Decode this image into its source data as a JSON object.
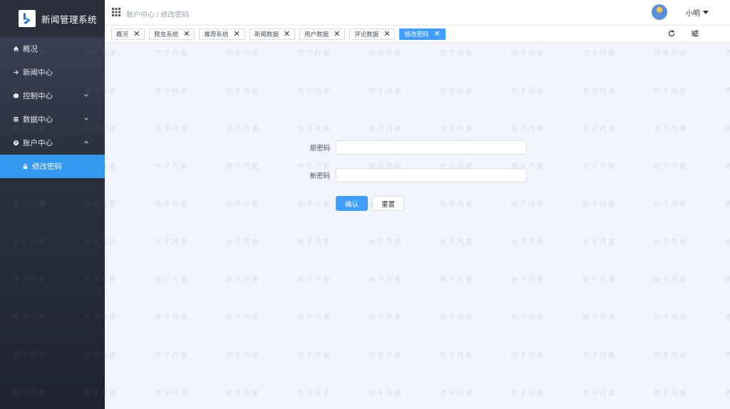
{
  "app": {
    "title": "新闻管理系统"
  },
  "sidebar": {
    "items": [
      {
        "label": "概况",
        "icon": "home-icon"
      },
      {
        "label": "新闻中心",
        "icon": "arrow-right-icon"
      },
      {
        "label": "控制中心",
        "icon": "cube-icon",
        "expandable": true
      },
      {
        "label": "数据中心",
        "icon": "database-icon",
        "expandable": true
      },
      {
        "label": "账户中心",
        "icon": "user-icon",
        "expandable": true,
        "expanded": true
      },
      {
        "label": "修改密码",
        "icon": "lock-icon",
        "active": true
      }
    ]
  },
  "header": {
    "breadcrumb": "账户中心 / 修改密码",
    "username": "小明"
  },
  "tabs": [
    {
      "label": "概况"
    },
    {
      "label": "爬虫系统"
    },
    {
      "label": "推荐系统"
    },
    {
      "label": "新闻数据"
    },
    {
      "label": "用户数据"
    },
    {
      "label": "评论数据"
    },
    {
      "label": "修改密码",
      "active": true
    }
  ],
  "tab_close_glyph": "✕",
  "form": {
    "old_password_label": "原密码",
    "old_password_value": "",
    "new_password_label": "新密码",
    "new_password_value": "",
    "confirm_label": "确认",
    "reset_label": "重置"
  },
  "watermark": {
    "text": "依子丹麦"
  },
  "colors": {
    "accent": "#409eff",
    "sidebar_active": "#3398ef",
    "sidebar_bg": "#2a303d",
    "main_bg": "#f2f5fc"
  }
}
